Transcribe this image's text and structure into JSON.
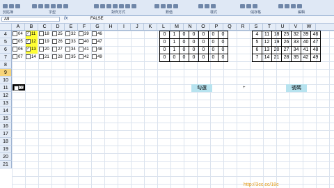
{
  "ribbon": {
    "labels": [
      "剪貼簿",
      "字型",
      "對齊方式",
      "數值",
      "樣式",
      "儲存格",
      "編輯"
    ]
  },
  "formula_bar": {
    "name_box": "A9",
    "fx": "fx",
    "value": "FALSE"
  },
  "columns": [
    "A",
    "B",
    "C",
    "D",
    "E",
    "F",
    "G",
    "H",
    "I",
    "J",
    "K",
    "L",
    "M",
    "N",
    "O",
    "P",
    "Q",
    "R",
    "S",
    "T",
    "U",
    "V",
    "W"
  ],
  "rows": [
    "4",
    "5",
    "6",
    "7",
    "8",
    "9",
    "10",
    "11",
    "12",
    "13",
    "14",
    "15",
    "16",
    "17",
    "18",
    "19",
    "20",
    "21"
  ],
  "checkboxes": [
    [
      {
        "n": "04",
        "c": false
      },
      {
        "n": "11",
        "c": true
      },
      {
        "n": "18",
        "c": false
      },
      {
        "n": "25",
        "c": false
      },
      {
        "n": "32",
        "c": false
      },
      {
        "n": "39",
        "c": false
      },
      {
        "n": "46",
        "c": false
      }
    ],
    [
      {
        "n": "05",
        "c": false
      },
      {
        "n": "12",
        "c": true
      },
      {
        "n": "19",
        "c": false
      },
      {
        "n": "26",
        "c": false
      },
      {
        "n": "33",
        "c": false
      },
      {
        "n": "40",
        "c": false
      },
      {
        "n": "47",
        "c": false
      }
    ],
    [
      {
        "n": "06",
        "c": false
      },
      {
        "n": "13",
        "c": true
      },
      {
        "n": "20",
        "c": false
      },
      {
        "n": "27",
        "c": false
      },
      {
        "n": "34",
        "c": false
      },
      {
        "n": "41",
        "c": false
      },
      {
        "n": "48",
        "c": false
      }
    ],
    [
      {
        "n": "07",
        "c": false
      },
      {
        "n": "14",
        "c": false
      },
      {
        "n": "21",
        "c": false
      },
      {
        "n": "28",
        "c": false
      },
      {
        "n": "35",
        "c": false
      },
      {
        "n": "42",
        "c": false
      },
      {
        "n": "49",
        "c": false
      }
    ]
  ],
  "flags": [
    [
      "0",
      "1",
      "0",
      "0",
      "0",
      "0",
      "0"
    ],
    [
      "0",
      "1",
      "0",
      "0",
      "0",
      "0",
      "0"
    ],
    [
      "0",
      "1",
      "0",
      "0",
      "0",
      "0",
      "0"
    ],
    [
      "0",
      "0",
      "0",
      "0",
      "0",
      "0",
      "0"
    ]
  ],
  "numbers": [
    [
      "4",
      "11",
      "18",
      "25",
      "32",
      "39",
      "46"
    ],
    [
      "5",
      "12",
      "19",
      "26",
      "33",
      "40",
      "47"
    ],
    [
      "6",
      "13",
      "20",
      "27",
      "34",
      "41",
      "48"
    ],
    [
      "7",
      "14",
      "21",
      "28",
      "35",
      "42",
      "49"
    ]
  ],
  "row9": {
    "checkbox_label": "01",
    "button_check": "勾選",
    "plus": "+",
    "button_number": "號碼"
  },
  "watermark": "http://3cc.cc/18c"
}
